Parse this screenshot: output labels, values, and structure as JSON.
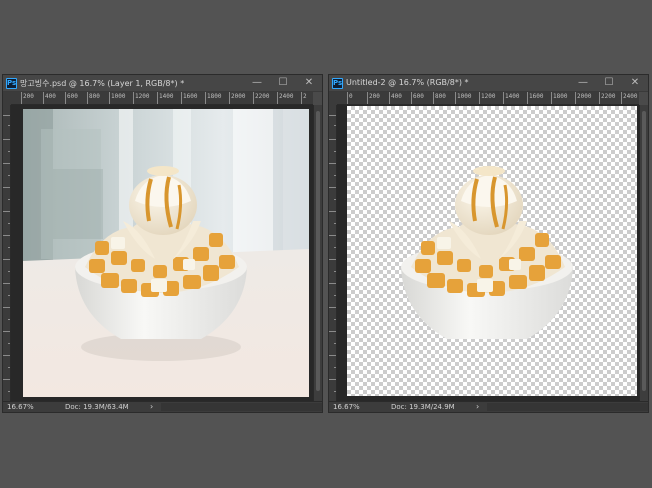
{
  "background_color": "#535353",
  "windows": [
    {
      "id": "left",
      "title": "망고빙수.psd @ 16.7% (Layer 1, RGB/8*) *",
      "ruler_labels": [
        "200",
        "400",
        "600",
        "800",
        "1000",
        "1200",
        "1400",
        "1600",
        "1800",
        "2000",
        "2200",
        "2400",
        "2"
      ],
      "zoom": "16.67%",
      "doc_info": "Doc: 19.3M/63.4M",
      "canvas": "photo"
    },
    {
      "id": "right",
      "title": "Untitled-2 @ 16.7% (RGB/8*) *",
      "ruler_labels": [
        "0",
        "200",
        "400",
        "600",
        "800",
        "1000",
        "1200",
        "1400",
        "1600",
        "1800",
        "2000",
        "2200",
        "2400",
        "2"
      ],
      "zoom": "16.67%",
      "doc_info": "Doc: 19.3M/24.9M",
      "canvas": "transparent"
    }
  ],
  "icons": {
    "app": "ps-icon",
    "minimize": "minimize-icon",
    "maximize": "maximize-icon",
    "close": "close-icon",
    "status_menu": "chevron-right-icon"
  }
}
